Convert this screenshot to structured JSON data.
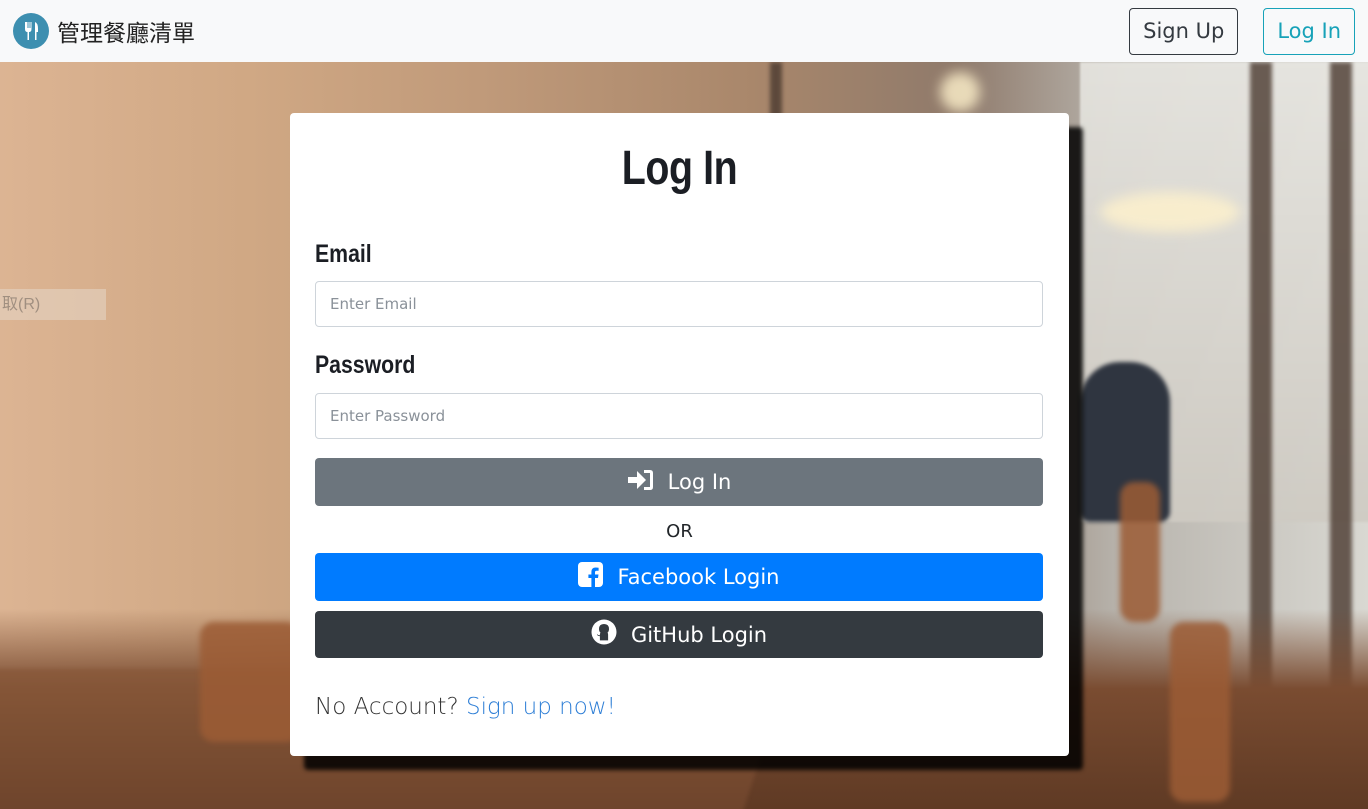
{
  "navbar": {
    "brand_text": "管理餐廳清單",
    "signup_label": "Sign Up",
    "login_label": "Log In"
  },
  "overlay": {
    "ghost_menu_text": "取(R)"
  },
  "form": {
    "title": "Log In",
    "email_label": "Email",
    "email_placeholder": "Enter Email",
    "email_value": "",
    "password_label": "Password",
    "password_placeholder": "Enter Password",
    "password_value": "",
    "login_button": "Log In",
    "or_text": "OR",
    "facebook_button": "Facebook Login",
    "github_button": "GitHub Login",
    "no_account_text": "No Account?",
    "signup_link": "Sign up now!"
  },
  "icons": {
    "brand": "utensils-icon",
    "login": "sign-in-icon",
    "facebook": "facebook-icon",
    "github": "github-icon"
  },
  "colors": {
    "brand_icon_bg": "#3d8fb0",
    "login_outline": "#17a2b8",
    "login_button": "#6c757d",
    "facebook_button": "#007bff",
    "github_button": "#343a40",
    "link": "#2f7fd6"
  }
}
